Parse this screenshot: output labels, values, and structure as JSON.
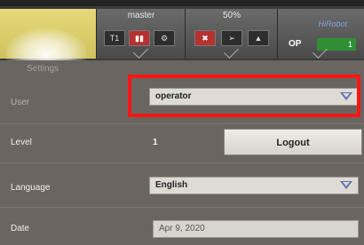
{
  "status_bar": {
    "mode_tile": {
      "label": "master",
      "buttons": [
        "T1",
        "",
        ""
      ]
    },
    "speed_tile": {
      "label": "50%"
    },
    "brand": "HiRobot",
    "op_tile": {
      "label": "OP",
      "value": "1"
    }
  },
  "panel": {
    "section_title": "Settings",
    "user": {
      "label": "User",
      "value": "operator"
    },
    "level": {
      "label": "Level",
      "value": "1",
      "logout_label": "Logout"
    },
    "language": {
      "label": "Language",
      "value": "English"
    },
    "date": {
      "label": "Date",
      "value": "Apr 9, 2020"
    }
  },
  "colors": {
    "highlight": "#ff1515",
    "yellow_tile": "#e2d575",
    "op_badge": "#2f8f35",
    "alert": "#b6312f"
  }
}
